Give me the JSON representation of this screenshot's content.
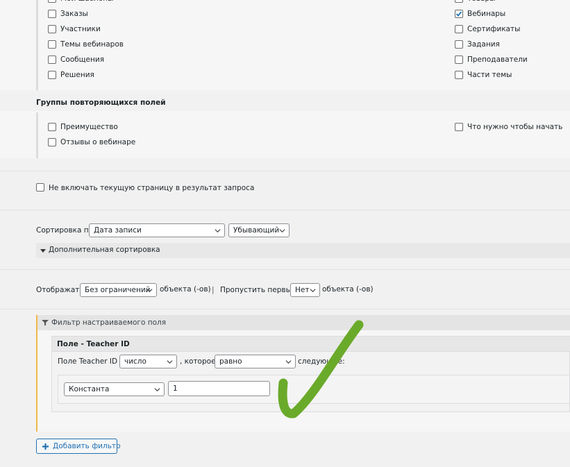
{
  "post_types": {
    "left": [
      {
        "label": "Мои шаблоны",
        "checked": false
      },
      {
        "label": "Заказы",
        "checked": false
      },
      {
        "label": "Участники",
        "checked": false
      },
      {
        "label": "Темы вебинаров",
        "checked": false
      },
      {
        "label": "Сообщения",
        "checked": false
      },
      {
        "label": "Решения",
        "checked": false
      }
    ],
    "right": [
      {
        "label": "Товары",
        "checked": false
      },
      {
        "label": "Вебинары",
        "checked": true
      },
      {
        "label": "Сертификаты",
        "checked": false
      },
      {
        "label": "Задания",
        "checked": false
      },
      {
        "label": "Преподаватели",
        "checked": false
      },
      {
        "label": "Части темы",
        "checked": false
      }
    ]
  },
  "repeater_groups": {
    "title": "Группы повторяющихся полей",
    "left": [
      {
        "label": "Преимущество",
        "checked": false
      },
      {
        "label": "Отзывы о вебинаре",
        "checked": false
      }
    ],
    "right": [
      {
        "label": "Что нужно чтобы начать",
        "checked": false
      }
    ]
  },
  "exclude_current": {
    "label": "Не включать текущую страницу в результат запроса",
    "checked": false
  },
  "sorting": {
    "label": "Сортировка по",
    "field": "Дата записи",
    "order": "Убывающий",
    "extra_toggle": "Дополнительная сортировка"
  },
  "display": {
    "label": "Отображать",
    "limit": "Без ограничений",
    "objects_1": "объекта (-ов)",
    "divider": "|",
    "skip_label": "Пропустить первые",
    "skip_value": "Нет",
    "objects_2": "объекта (-ов)"
  },
  "custom_filter": {
    "title": "Фильтр настраиваемого поля",
    "field_title": "Поле - Teacher ID",
    "condition_prefix": "Поле Teacher ID –",
    "type_value": "число",
    "which_label": ", которое",
    "operator_value": "равно",
    "following": "следующее:",
    "source_value": "Константа",
    "input_value": "1"
  },
  "add_filter_button": "Добавить фильтр",
  "colors": {
    "accent": "#2271b1",
    "check_mark": "#6aaa2a",
    "filter_border": "#f0b849"
  }
}
